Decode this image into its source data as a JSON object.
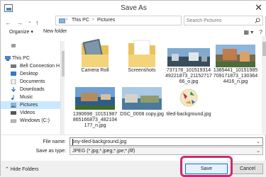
{
  "window": {
    "title": "Save As",
    "close_glyph": "✕"
  },
  "nav": {
    "back_glyph": "←",
    "forward_glyph": "→",
    "recent_glyph": "⌄",
    "up_glyph": "↑",
    "breadcrumb": [
      "This PC",
      "Pictures"
    ],
    "breadcrumb_sep": "›",
    "dropdown_glyph": "⌄",
    "refresh_glyph": "↻",
    "search_placeholder": "Search Pictures"
  },
  "commands": {
    "organize": "Organize ▾",
    "new_folder": "New folder",
    "view_glyph": "▦ ▾",
    "help_glyph": "?"
  },
  "sidebar": {
    "items": [
      {
        "label": "",
        "icon": "generic-icon"
      },
      {
        "label": "This PC",
        "icon": "computer-icon"
      },
      {
        "label": "Bell Connection H",
        "icon": "network-icon"
      },
      {
        "label": "Desktop",
        "icon": "desktop-icon"
      },
      {
        "label": "Documents",
        "icon": "documents-icon"
      },
      {
        "label": "Downloads",
        "icon": "downloads-icon"
      },
      {
        "label": "Music",
        "icon": "music-icon"
      },
      {
        "label": "Pictures",
        "icon": "pictures-icon"
      },
      {
        "label": "Videos",
        "icon": "videos-icon"
      },
      {
        "label": "Windows (C:)",
        "icon": "drive-icon"
      }
    ],
    "selected": "Pictures"
  },
  "files": [
    {
      "name": "Camera Roll",
      "kind": "folder"
    },
    {
      "name": "Screenshots",
      "kind": "folder"
    },
    {
      "name": "737178_10151931449221873_2115271766_o.jpg",
      "kind": "image"
    },
    {
      "name": "1385441_10151985709171873_1303644416_n.jpg",
      "kind": "image"
    },
    {
      "name": "1390698_10151987865166873_482104177_n.jpg",
      "kind": "image"
    },
    {
      "name": "DSC_0008 copy.jpg",
      "kind": "image"
    },
    {
      "name": "tiled-background.jpg",
      "kind": "image"
    }
  ],
  "form": {
    "file_name_label": "File name:",
    "file_name_value": "tiny-tiled-background.jpg",
    "save_type_label": "Save as type:",
    "save_type_value": "JPEG (*.jpg;*.jpeg;*.jpe;*.jfif)"
  },
  "footer": {
    "hide_folders": "⌃ Hide Folders",
    "save": "Save",
    "cancel": "Cancel"
  },
  "colors": {
    "selection": "#cce8ff",
    "accent": "#0078d7",
    "highlight": "#c82d6e"
  }
}
